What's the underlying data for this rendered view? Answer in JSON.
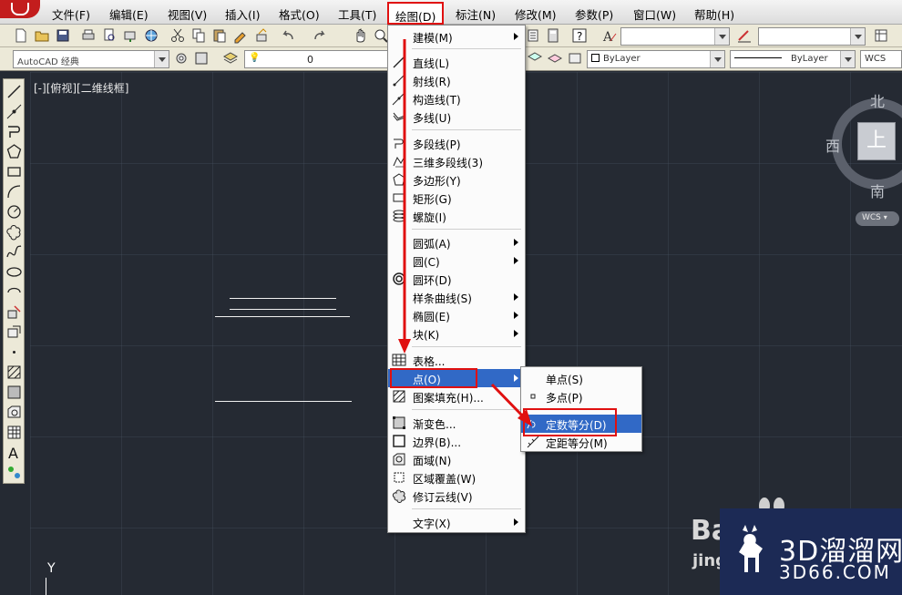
{
  "menubar": {
    "items": [
      "文件(F)",
      "编辑(E)",
      "视图(V)",
      "插入(I)",
      "格式(O)",
      "工具(T)",
      "绘图(D)",
      "标注(N)",
      "修改(M)",
      "参数(P)",
      "窗口(W)",
      "帮助(H)"
    ]
  },
  "toolbar2": {
    "workspace": "AutoCAD 经典",
    "layer_value": "0",
    "color": "ByLayer",
    "linetype": "ByLayer",
    "wcs": "WCS"
  },
  "viewport": {
    "label": "[-][俯视][二维线框]"
  },
  "viewcube": {
    "north": "北",
    "south": "南",
    "west": "西",
    "face": "上",
    "wcs_button": "WCS"
  },
  "ucs": {
    "y_label": "Y"
  },
  "draw_menu": {
    "items": [
      {
        "label": "建模(M)",
        "submenu": true
      },
      {
        "label": "直线(L)"
      },
      {
        "label": "射线(R)"
      },
      {
        "label": "构造线(T)"
      },
      {
        "label": "多线(U)"
      },
      {
        "label": "多段线(P)"
      },
      {
        "label": "三维多段线(3)"
      },
      {
        "label": "多边形(Y)"
      },
      {
        "label": "矩形(G)"
      },
      {
        "label": "螺旋(I)"
      },
      {
        "label": "圆弧(A)",
        "submenu": true
      },
      {
        "label": "圆(C)",
        "submenu": true
      },
      {
        "label": "圆环(D)"
      },
      {
        "label": "样条曲线(S)",
        "submenu": true
      },
      {
        "label": "椭圆(E)",
        "submenu": true
      },
      {
        "label": "块(K)",
        "submenu": true
      },
      {
        "label": "表格..."
      },
      {
        "label": "点(O)",
        "submenu": true,
        "highlighted": true
      },
      {
        "label": "图案填充(H)..."
      },
      {
        "label": "渐变色..."
      },
      {
        "label": "边界(B)..."
      },
      {
        "label": "面域(N)"
      },
      {
        "label": "区域覆盖(W)"
      },
      {
        "label": "修订云线(V)"
      },
      {
        "label": "文字(X)",
        "submenu": true
      }
    ]
  },
  "point_submenu": {
    "items": [
      {
        "label": "单点(S)"
      },
      {
        "label": "多点(P)"
      },
      {
        "label": "定数等分(D)",
        "highlighted": true
      },
      {
        "label": "定距等分(M)"
      }
    ]
  },
  "watermark": {
    "brand_cn": "3D溜溜网",
    "brand_url": "3D66.COM",
    "ba": "Ba",
    "jing": "jing"
  },
  "colors": {
    "menu_highlight": "#3169c6",
    "annotation_red": "#e01010",
    "canvas_bg": "#252a33"
  }
}
